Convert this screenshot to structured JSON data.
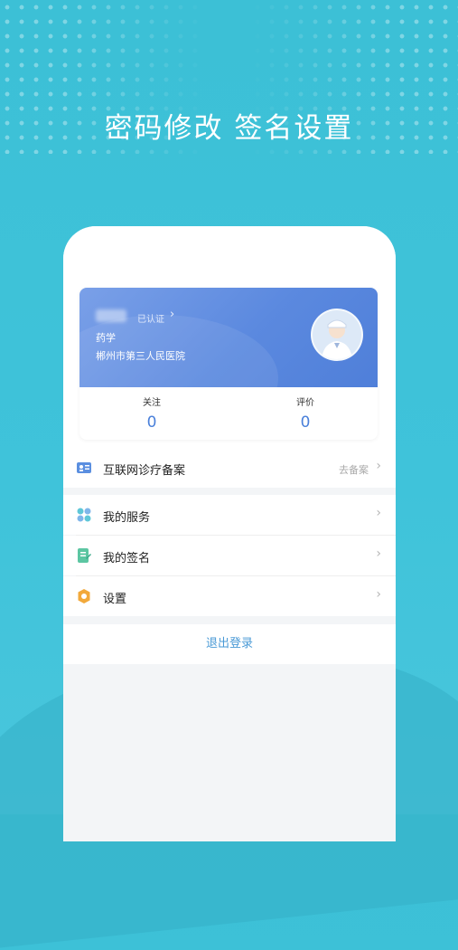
{
  "headline": "密码修改 签名设置",
  "profile": {
    "verified": "已认证",
    "department": "药学",
    "hospital": "郴州市第三人民医院",
    "stats": [
      {
        "label": "关注",
        "value": "0"
      },
      {
        "label": "评价",
        "value": "0"
      }
    ]
  },
  "menu": {
    "filing": {
      "label": "互联网诊疗备案",
      "action": "去备案"
    },
    "items": [
      {
        "label": "我的服务"
      },
      {
        "label": "我的签名"
      },
      {
        "label": "设置"
      }
    ]
  },
  "logout_label": "退出登录",
  "colors": {
    "background": "#3fc3da",
    "card_blue": "#5b89df",
    "link": "#4a9ad6"
  }
}
